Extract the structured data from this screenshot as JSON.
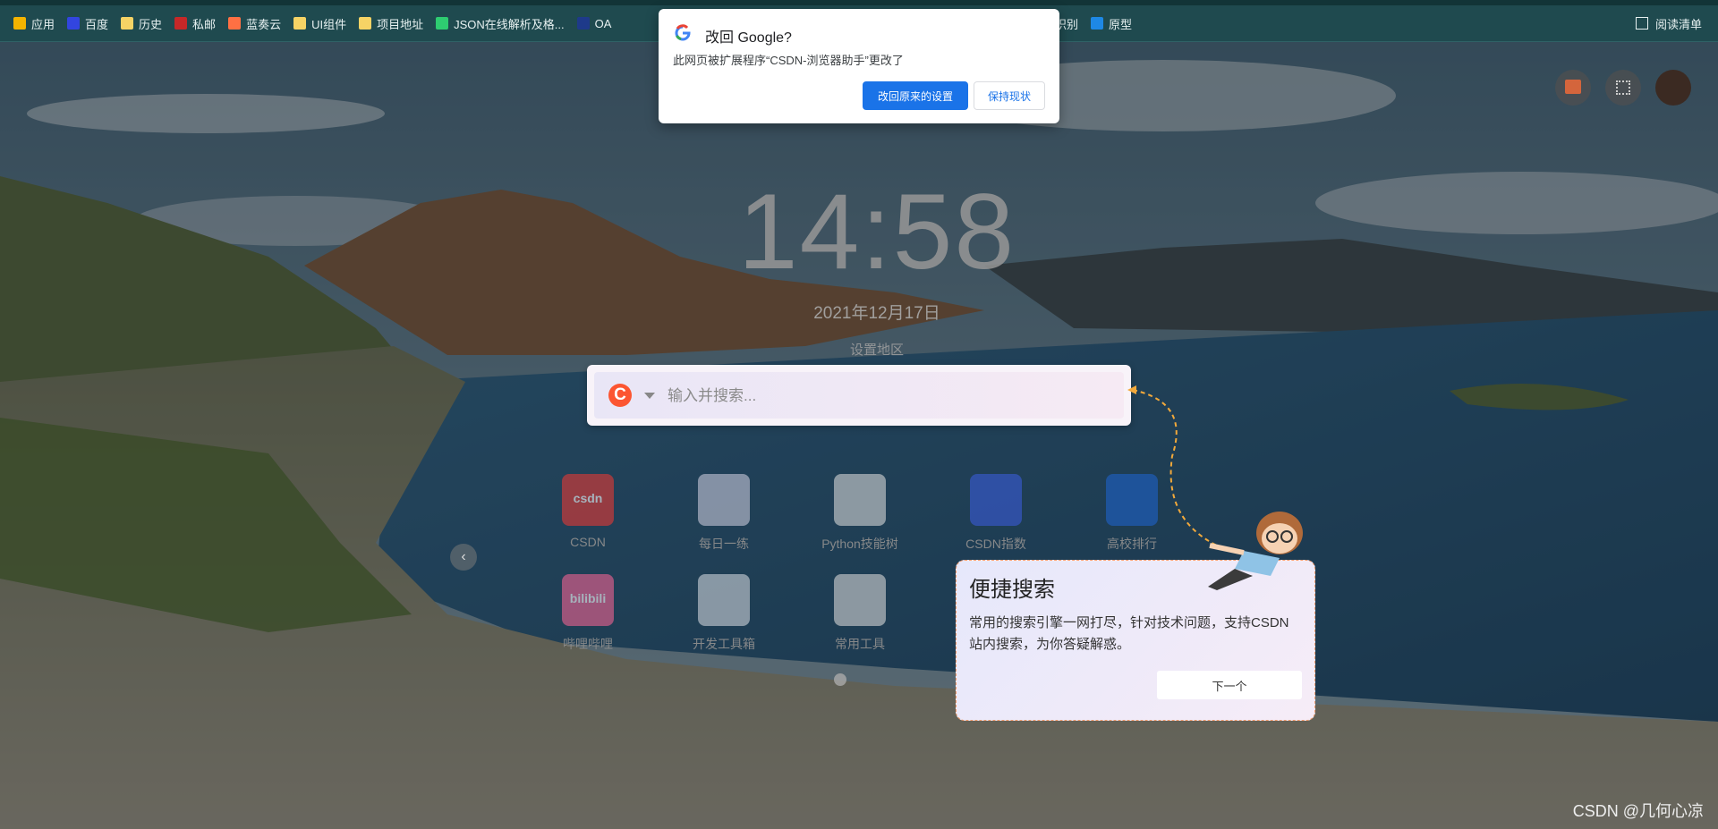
{
  "bookmarks_bar": {
    "items": [
      {
        "label": "应用",
        "icon": "apps-grid-icon",
        "color": "#f4b400"
      },
      {
        "label": "百度",
        "icon": "baidu-icon",
        "color": "#3245df"
      },
      {
        "label": "历史",
        "icon": "folder-icon",
        "color": "#f6d365"
      },
      {
        "label": "私邮",
        "icon": "mail-icon",
        "color": "#c62828"
      },
      {
        "label": "蓝奏云",
        "icon": "lanzou-icon",
        "color": "#ff7043"
      },
      {
        "label": "UI组件",
        "icon": "folder-icon",
        "color": "#f6d365"
      },
      {
        "label": "项目地址",
        "icon": "folder-icon",
        "color": "#f6d365"
      },
      {
        "label": "JSON在线解析及格...",
        "icon": "json-icon",
        "color": "#2ecc71"
      },
      {
        "label": "OA",
        "icon": "oa-icon",
        "color": "#1e3a8a"
      }
    ],
    "partial_items": [
      {
        "label": "识别",
        "icon": "generic-icon",
        "color": "#ffffff"
      },
      {
        "label": "原型",
        "icon": "prototype-icon",
        "color": "#1e88e5"
      }
    ],
    "reading_list": "阅读清单"
  },
  "clock": {
    "time": "14:58",
    "date": "2021年12月17日",
    "region_link": "设置地区"
  },
  "search": {
    "placeholder": "输入并搜索...",
    "engine_icon": "csdn-c-icon",
    "engine_letter": "C"
  },
  "shortcuts": [
    {
      "label": "CSDN",
      "icon": "csdn-icon",
      "color": "#e53935",
      "tile_text": "csdn"
    },
    {
      "label": "每日一练",
      "icon": "daily-practice-icon",
      "color": "#c8c8d8",
      "tile_text": ""
    },
    {
      "label": "Python技能树",
      "icon": "skill-tree-icon",
      "color": "#d6d6d6",
      "tile_text": ""
    },
    {
      "label": "CSDN指数",
      "icon": "csdn-index-icon",
      "color": "#3a5bd9",
      "tile_text": ""
    },
    {
      "label": "高校排行",
      "icon": "university-ranking-icon",
      "color": "#1e62c9",
      "tile_text": ""
    },
    {
      "label": "哔哩哔哩",
      "icon": "bilibili-icon",
      "color": "#f06292",
      "tile_text": "bilibili"
    },
    {
      "label": "开发工具箱",
      "icon": "dev-toolbox-icon",
      "color": "#cfd4db",
      "tile_text": ""
    },
    {
      "label": "常用工具",
      "icon": "common-tools-icon",
      "color": "#d5d5d5",
      "tile_text": ""
    }
  ],
  "google_popup": {
    "title": "改回 Google?",
    "description": "此网页被扩展程序“CSDN-浏览器助手”更改了",
    "restore_button": "改回原来的设置",
    "keep_button": "保持现状"
  },
  "guide": {
    "title": "便捷搜索",
    "text": "常用的搜索引擎一网打尽，针对技术问题，支持CSDN站内搜索，为你答疑解惑。",
    "next_button": "下一个"
  },
  "watermark": "CSDN @几何心凉"
}
